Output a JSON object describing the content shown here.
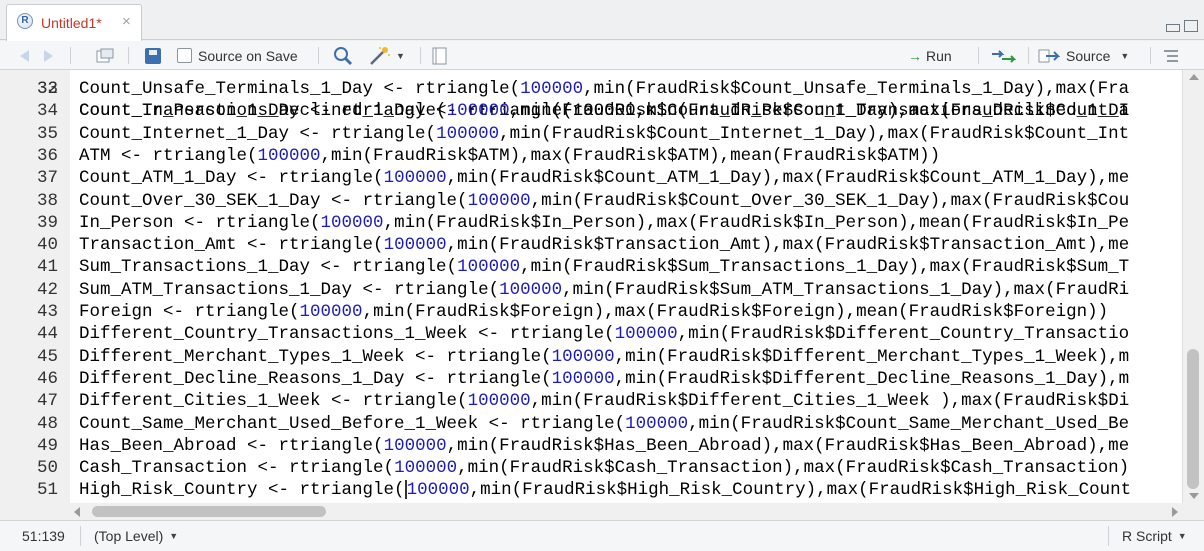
{
  "tab": {
    "title": "Untitled1*",
    "close_glyph": "×"
  },
  "toolbar": {
    "source_on_save_label": "Source on Save",
    "run_label": "Run",
    "source_label": "Source",
    "run_icon": "→",
    "search_icon": "magnifier-icon",
    "wand_icon": "wand-icon"
  },
  "editor": {
    "partial_top_line": {
      "number": "32",
      "text": "Count_Transactions_Declined_1_Day <- rtriangle(100000,min(FraudRisk$Count_Transactions_Declined_1_Da"
    },
    "lines": [
      {
        "n": "33",
        "pre": "Count_Unsafe_Terminals_1_Day <- rtriangle(",
        "num": "100000",
        "post": ",min(FraudRisk$Count_Unsafe_Terminals_1_Day),max(Fra"
      },
      {
        "n": "34",
        "pre": "Count_In_Person_1_Day <- rtriangle(",
        "num": "100000",
        "post": ",min(FraudRisk$Count_In_Person_1_Day),max(FraudRisk$Count_I"
      },
      {
        "n": "35",
        "pre": "Count_Internet_1_Day <- rtriangle(",
        "num": "100000",
        "post": ",min(FraudRisk$Count_Internet_1_Day),max(FraudRisk$Count_Int"
      },
      {
        "n": "36",
        "pre": "ATM <- rtriangle(",
        "num": "100000",
        "post": ",min(FraudRisk$ATM),max(FraudRisk$ATM),mean(FraudRisk$ATM))"
      },
      {
        "n": "37",
        "pre": "Count_ATM_1_Day <- rtriangle(",
        "num": "100000",
        "post": ",min(FraudRisk$Count_ATM_1_Day),max(FraudRisk$Count_ATM_1_Day),me"
      },
      {
        "n": "38",
        "pre": "Count_Over_30_SEK_1_Day <- rtriangle(",
        "num": "100000",
        "post": ",min(FraudRisk$Count_Over_30_SEK_1_Day),max(FraudRisk$Cou"
      },
      {
        "n": "39",
        "pre": "In_Person <- rtriangle(",
        "num": "100000",
        "post": ",min(FraudRisk$In_Person),max(FraudRisk$In_Person),mean(FraudRisk$In_Pe"
      },
      {
        "n": "40",
        "pre": "Transaction_Amt <- rtriangle(",
        "num": "100000",
        "post": ",min(FraudRisk$Transaction_Amt),max(FraudRisk$Transaction_Amt),me"
      },
      {
        "n": "41",
        "pre": "Sum_Transactions_1_Day <- rtriangle(",
        "num": "100000",
        "post": ",min(FraudRisk$Sum_Transactions_1_Day),max(FraudRisk$Sum_T"
      },
      {
        "n": "42",
        "pre": "Sum_ATM_Transactions_1_Day <- rtriangle(",
        "num": "100000",
        "post": ",min(FraudRisk$Sum_ATM_Transactions_1_Day),max(FraudRi"
      },
      {
        "n": "43",
        "pre": "Foreign <- rtriangle(",
        "num": "100000",
        "post": ",min(FraudRisk$Foreign),max(FraudRisk$Foreign),mean(FraudRisk$Foreign))"
      },
      {
        "n": "44",
        "pre": "Different_Country_Transactions_1_Week <- rtriangle(",
        "num": "100000",
        "post": ",min(FraudRisk$Different_Country_Transactio"
      },
      {
        "n": "45",
        "pre": "Different_Merchant_Types_1_Week <- rtriangle(",
        "num": "100000",
        "post": ",min(FraudRisk$Different_Merchant_Types_1_Week),m"
      },
      {
        "n": "46",
        "pre": "Different_Decline_Reasons_1_Day <- rtriangle(",
        "num": "100000",
        "post": ",min(FraudRisk$Different_Decline_Reasons_1_Day),m"
      },
      {
        "n": "47",
        "pre": "Different_Cities_1_Week <- rtriangle(",
        "num": "100000",
        "post": ",min(FraudRisk$Different_Cities_1_Week ),max(FraudRisk$Di"
      },
      {
        "n": "48",
        "pre": "Count_Same_Merchant_Used_Before_1_Week <- rtriangle(",
        "num": "100000",
        "post": ",min(FraudRisk$Count_Same_Merchant_Used_Be"
      },
      {
        "n": "49",
        "pre": "Has_Been_Abroad <- rtriangle(",
        "num": "100000",
        "post": ",min(FraudRisk$Has_Been_Abroad),max(FraudRisk$Has_Been_Abroad),me"
      },
      {
        "n": "50",
        "pre": "Cash_Transaction <- rtriangle(",
        "num": "100000",
        "post": ",min(FraudRisk$Cash_Transaction),max(FraudRisk$Cash_Transaction)"
      },
      {
        "n": "51",
        "pre": "High_Risk_Country <- rtriangle(",
        "num": "100000",
        "post": ",min(FraudRisk$High_Risk_Country),max(FraudRisk$High_Risk_Count",
        "cursor": true
      }
    ]
  },
  "status": {
    "position": "51:139",
    "scope": "(Top Level)",
    "file_type": "R Script"
  }
}
